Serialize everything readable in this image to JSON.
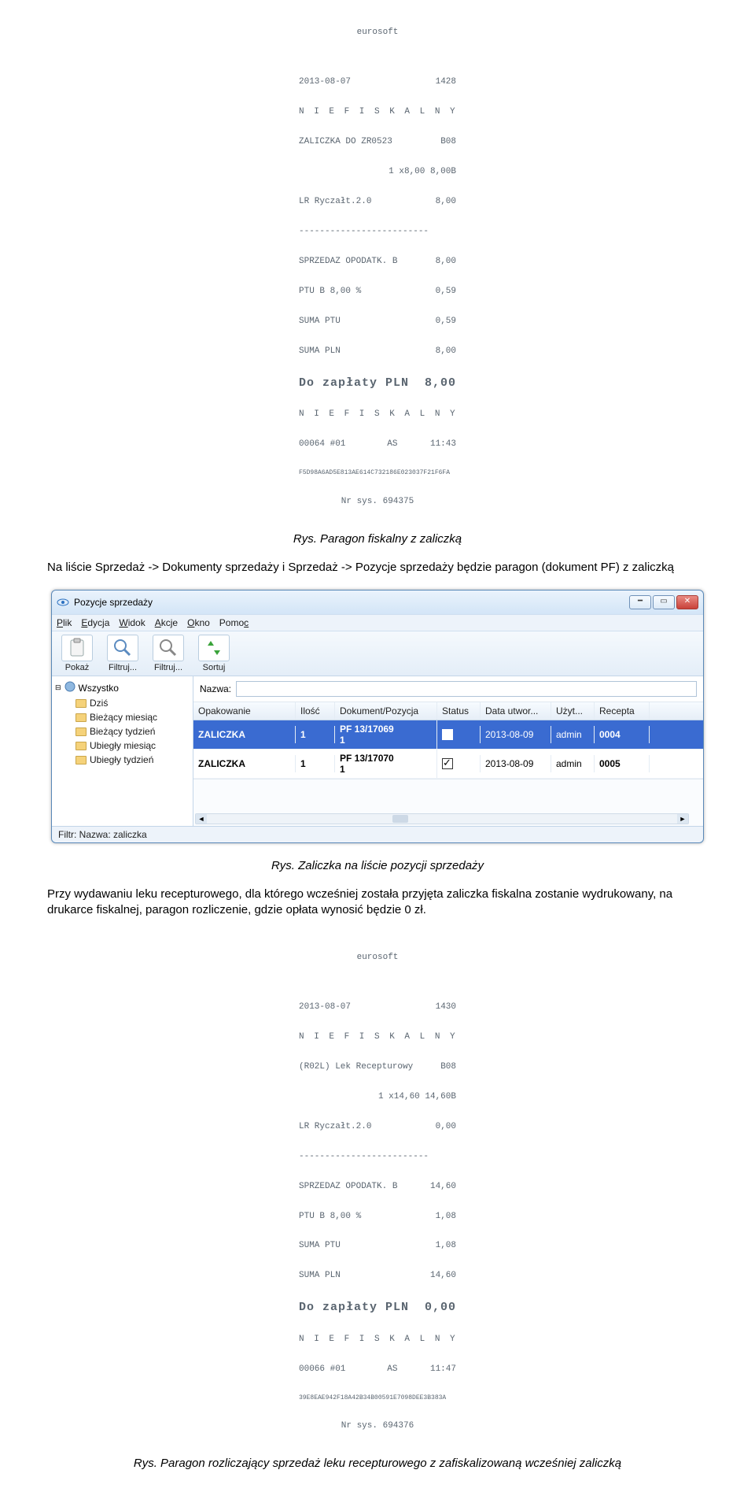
{
  "receipt1": {
    "brand": "eurosoft",
    "date": "2013-08-07",
    "num_right": "1428",
    "niefiskalny": "N I E F I S K A L N Y",
    "line_a_left": "ZALICZKA DO ZR0523",
    "line_a_right": "B08",
    "line_b_left": "",
    "line_b_right": "1 x8,00 8,00B",
    "line_c_left": "LR Ryczałt.2.0",
    "line_c_right": "8,00",
    "sp_left": "SPRZEDAZ OPODATK. B",
    "sp_right": "8,00",
    "ptu_left": "PTU B 8,00 %",
    "ptu_right": "0,59",
    "sumaptu_left": "SUMA PTU",
    "sumaptu_right": "0,59",
    "sumapln_left": "SUMA PLN",
    "sumapln_right": "8,00",
    "total": "Do zapłaty PLN  8,00",
    "foot1_left": "00064 #01        AS",
    "foot1_right": "11:43",
    "hash": "F5D98A6AD5E813AE614C732186E023037F21F6FA",
    "nrsys": "Nr sys. 694375"
  },
  "caption1": "Rys. Paragon fiskalny z zaliczką",
  "body1": "Na liście Sprzedaż -> Dokumenty sprzedaży i Sprzedaż -> Pozycje sprzedaży będzie paragon (dokument PF) z zaliczką",
  "window": {
    "title": "Pozycje sprzedaży",
    "menu": [
      "Plik",
      "Edycja",
      "Widok",
      "Akcje",
      "Okno",
      "Pomoc"
    ],
    "toolbar": [
      {
        "label": "Pokaż"
      },
      {
        "label": "Filtruj..."
      },
      {
        "label": "Filtruj..."
      },
      {
        "label": "Sortuj"
      }
    ],
    "tree_root": "Wszystko",
    "tree": [
      "Dziś",
      "Bieżący miesiąc",
      "Bieżący tydzień",
      "Ubiegły miesiąc",
      "Ubiegły tydzień"
    ],
    "filter_label": "Nazwa:",
    "filter_value": "",
    "columns": [
      "Opakowanie",
      "Ilość",
      "Dokument/Pozycja",
      "Status",
      "Data utwor...",
      "Użyt...",
      "Recepta"
    ],
    "rows": [
      {
        "opak": "ZALICZKA",
        "ilosc": "1",
        "dok": "PF 13/17069",
        "dok2": "1",
        "status": true,
        "data": "2013-08-09",
        "uzyt": "admin",
        "recepta": "0004",
        "selected": true
      },
      {
        "opak": "ZALICZKA",
        "ilosc": "1",
        "dok": "PF 13/17070",
        "dok2": "1",
        "status": true,
        "data": "2013-08-09",
        "uzyt": "admin",
        "recepta": "0005",
        "selected": false
      }
    ],
    "statusbar": "Filtr: Nazwa: zaliczka"
  },
  "caption2": "Rys. Zaliczka na liście pozycji sprzedaży",
  "body2": "Przy wydawaniu leku recepturowego, dla którego wcześniej została przyjęta zaliczka fiskalna zostanie wydrukowany, na drukarce fiskalnej, paragon rozliczenie, gdzie opłata wynosić będzie 0 zł.",
  "receipt2": {
    "brand": "eurosoft",
    "date": "2013-08-07",
    "num_right": "1430",
    "niefiskalny": "N I E F I S K A L N Y",
    "line_a_left": "(R02L) Lek Recepturowy",
    "line_a_right": "B08",
    "line_b_right": "1 x14,60 14,60B",
    "line_c_left": "LR Ryczałt.2.0",
    "line_c_right": "0,00",
    "sp_left": "SPRZEDAZ OPODATK. B",
    "sp_right": "14,60",
    "ptu_left": "PTU B 8,00 %",
    "ptu_right": "1,08",
    "sumaptu_left": "SUMA PTU",
    "sumaptu_right": "1,08",
    "sumapln_left": "SUMA PLN",
    "sumapln_right": "14,60",
    "total": "Do zapłaty PLN  0,00",
    "foot1_left": "00066 #01        AS",
    "foot1_right": "11:47",
    "hash": "39E8EAE942F18A42B34B00591E7098DEE3B383A",
    "nrsys": "Nr sys. 694376"
  },
  "caption3": "Rys. Paragon rozliczający sprzedaż leku recepturowego z zafiskalizowaną wcześniej zaliczką"
}
